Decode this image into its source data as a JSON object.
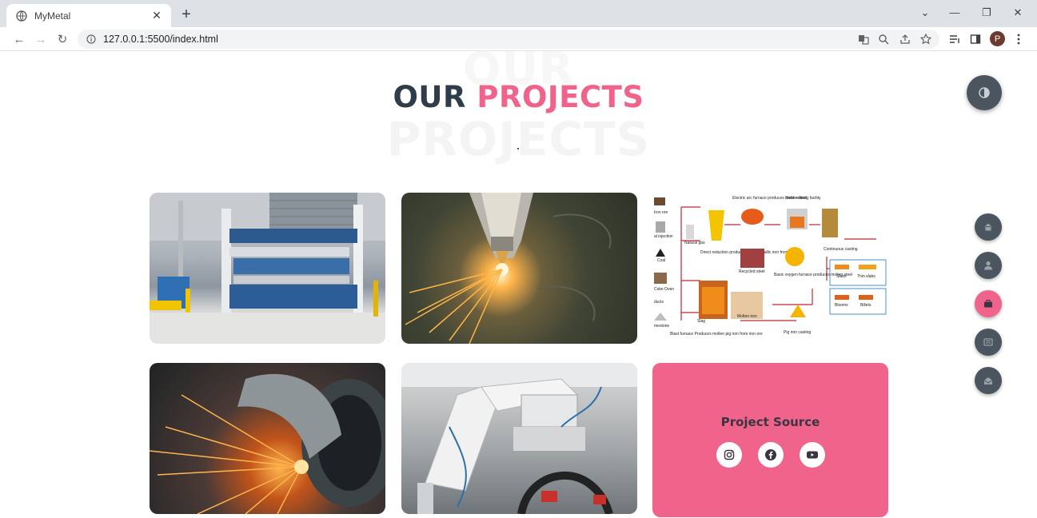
{
  "browser": {
    "tab_title": "MyMetal",
    "url": "127.0.0.1:5500/index.html",
    "avatar_letter": "P"
  },
  "page": {
    "bg_line1": "OUR",
    "bg_line2": "PROJECTS",
    "title_word1": "OUR",
    "title_word2": "PROJECTS"
  },
  "projects": [
    {
      "name": "project-sheet-metal-machine"
    },
    {
      "name": "project-laser-cutting"
    },
    {
      "name": "project-steelmaking-diagram"
    },
    {
      "name": "project-grinding-sparks"
    },
    {
      "name": "project-industrial-robot"
    }
  ],
  "diagram_labels": {
    "iron_ore": "Iron ore",
    "pulverized": "al injection",
    "natural_gas": "Natural gas",
    "coal": "Coal",
    "coke_oven": "Coke Oven",
    "products": "ducts",
    "limestone": "mestone",
    "eaf": "Electric arc furnace produces molten steel",
    "refining": "Steel refining facility",
    "continuous_casting": "Continuous casting",
    "direct_reduction": "Direct reduction produces solid, metallic iron from iron ore",
    "recycled": "Recycled steel",
    "bof": "Basic oxygen furnace produces molten steel",
    "slabs": "Slabs",
    "thin_slabs": "Thin slabs",
    "blooms": "Blooms",
    "billets": "Billets",
    "slag": "Slag",
    "molten_iron": "Molten iron",
    "blast_furnace": "Blast furnace Produces molten pig iron from iron ore",
    "pig_iron": "Pig iron casting"
  },
  "source_card": {
    "title": "Project Source",
    "social": [
      "instagram-icon",
      "facebook-icon",
      "youtube-icon"
    ]
  },
  "colors": {
    "accent": "#f0648b",
    "dark": "#2f3d4a",
    "nav": "#4a5560"
  }
}
